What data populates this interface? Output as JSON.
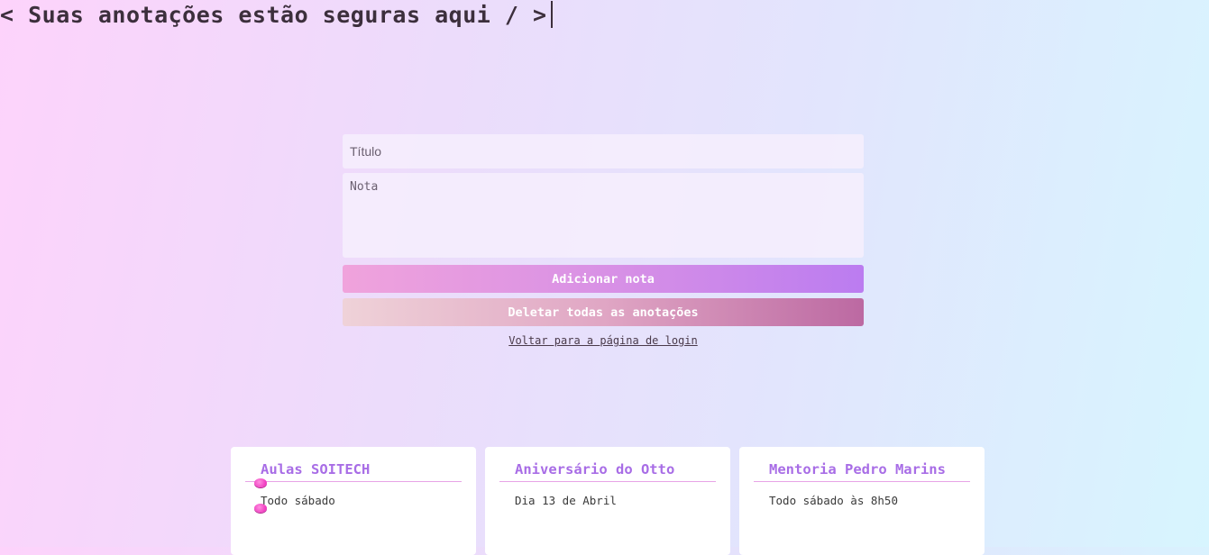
{
  "header": {
    "title": "< Suas anotações estão seguras aqui / >"
  },
  "form": {
    "title_placeholder": "Título",
    "title_value": "",
    "note_placeholder": "Nota",
    "note_value": "",
    "add_button_label": "Adicionar nota",
    "delete_all_button_label": "Deletar todas as anotações",
    "back_link_label": "Voltar para a página de login"
  },
  "notes": [
    {
      "title": "Aulas SOITECH",
      "text": "Todo sábado"
    },
    {
      "title": "Aniversário do Otto",
      "text": "Dia 13 de Abril"
    },
    {
      "title": "Mentoria Pedro Marins",
      "text": "Todo sábado às 8h50"
    }
  ],
  "colors": {
    "accent": "#a86de6",
    "add_button_start": "#f0a3dc",
    "add_button_end": "#bb7cf0",
    "delete_button_start": "#efd2d8",
    "delete_button_end": "#bc69a2",
    "pin": "#f03cc0"
  },
  "icons": {
    "pin": "pin-icon"
  }
}
